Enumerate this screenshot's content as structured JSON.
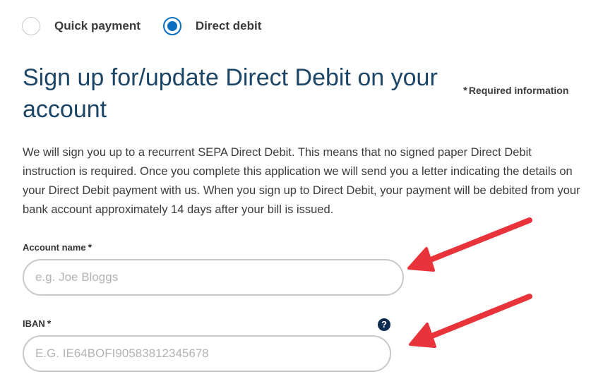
{
  "payment_options": {
    "quick_payment_label": "Quick payment",
    "direct_debit_label": "Direct debit",
    "selected": "Direct debit"
  },
  "page_title": "Sign up for/update Direct Debit on your account",
  "required_info": {
    "star": "*",
    "label": "Required information"
  },
  "description": "We will sign you up to a recurrent SEPA Direct Debit. This means that no signed paper Direct Debit instruction is required. Once you complete this application we will send you a letter indicating the details on your Direct Debit payment with us. When you sign up to Direct Debit, your payment will be debited from your bank account approximately 14 days after your bill is issued.",
  "fields": {
    "account_name": {
      "label": "Account name",
      "required_marker": "*",
      "value": "",
      "placeholder": "e.g. Joe Bloggs"
    },
    "iban": {
      "label": "IBAN",
      "required_marker": "*",
      "value": "",
      "placeholder": "E.G. IE64BOFI90583812345678",
      "help_glyph": "?"
    }
  },
  "annotations": {
    "arrow_color": "#e8333a",
    "arrow_icon": "red-arrow"
  },
  "colors": {
    "accent": "#0a6fc2",
    "title": "#1d4566",
    "help_icon": "#0d2c52"
  }
}
